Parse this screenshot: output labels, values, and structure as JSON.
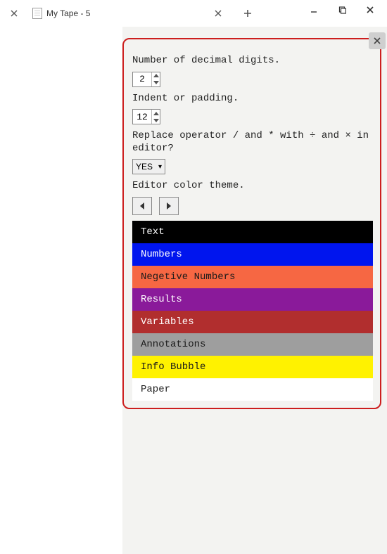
{
  "tab": {
    "title": "My Tape - 5"
  },
  "panel": {
    "decimal_label": "Number of decimal digits.",
    "decimal_value": "2",
    "indent_label": "Indent or padding.",
    "indent_value": "12",
    "replace_label": "Replace operator / and * with ÷ and × in editor?",
    "replace_value": "YES",
    "theme_label": "Editor color theme.",
    "theme_rows": [
      {
        "label": "Text",
        "bg": "#000000",
        "fg": "#ffffff"
      },
      {
        "label": "Numbers",
        "bg": "#0015ee",
        "fg": "#ffffff"
      },
      {
        "label": "Negetive Numbers",
        "bg": "#f66743",
        "fg": "#1a1a1a"
      },
      {
        "label": "Results",
        "bg": "#8a1a9a",
        "fg": "#ffffff"
      },
      {
        "label": "Variables",
        "bg": "#b12e2e",
        "fg": "#ffffff"
      },
      {
        "label": "Annotations",
        "bg": "#9e9e9e",
        "fg": "#1a1a1a"
      },
      {
        "label": "Info Bubble",
        "bg": "#fff200",
        "fg": "#1a1a1a"
      },
      {
        "label": "Paper",
        "bg": "#ffffff",
        "fg": "#1a1a1a"
      }
    ]
  }
}
